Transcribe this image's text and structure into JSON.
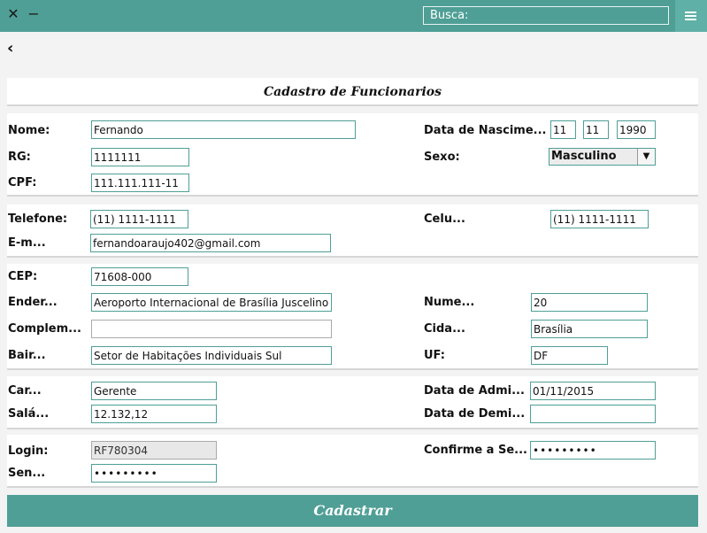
{
  "window": {
    "close_glyph": "✕",
    "minimize_glyph": "−"
  },
  "search": {
    "placeholder": "Busca:"
  },
  "back": {
    "glyph": "‹"
  },
  "form_title": "Cadastro de Funcionarios",
  "personal": {
    "nome_label": "Nome:",
    "nome_value": "Fernando",
    "nascimento_label": "Data de Nascime...",
    "nascimento_dia": "11",
    "nascimento_mes": "11",
    "nascimento_ano": "1990",
    "rg_label": "RG:",
    "rg_value": "1111111",
    "sexo_label": "Sexo:",
    "sexo_value": "Masculino",
    "cpf_label": "CPF:",
    "cpf_value": "111.111.111-11"
  },
  "contact": {
    "telefone_label": "Telefone:",
    "telefone_value": "(11) 1111-1111",
    "celular_label": "Celu...",
    "celular_value": "(11) 1111-1111",
    "email_label": "E-m...",
    "email_value": "fernandoaraujo402@gmail.com"
  },
  "address": {
    "cep_label": "CEP:",
    "cep_value": "71608-000",
    "endereco_label": "Ender...",
    "endereco_value": "Aeroporto Internacional de Brasília Juscelino",
    "numero_label": "Nume...",
    "numero_value": "20",
    "complemento_label": "Complem...",
    "complemento_value": "",
    "cidade_label": "Cida...",
    "cidade_value": "Brasília",
    "bairro_label": "Bair...",
    "bairro_value": "Setor de Habitações Individuais Sul",
    "uf_label": "UF:",
    "uf_value": "DF"
  },
  "job": {
    "cargo_label": "Car...",
    "cargo_value": "Gerente",
    "admissao_label": "Data de Admi...",
    "admissao_value": "01/11/2015",
    "salario_label": "Salá...",
    "salario_value": "12.132,12",
    "demissao_label": "Data de Demi...",
    "demissao_value": ""
  },
  "account": {
    "login_label": "Login:",
    "login_value": "RF780304",
    "confirme_label": "Confirme a Se...",
    "confirme_value": "•••••••••",
    "senha_label": "Sen...",
    "senha_value": "•••••••••"
  },
  "submit_label": "Cadastrar",
  "colors": {
    "accent": "#4f9f96",
    "panel": "#ffffff",
    "background": "#f3f3f3"
  },
  "icons": {
    "close": "close-icon",
    "minimize": "minimize-icon",
    "menu": "hamburger-menu-icon",
    "back": "chevron-left-icon",
    "dropdown": "chevron-down-icon"
  }
}
